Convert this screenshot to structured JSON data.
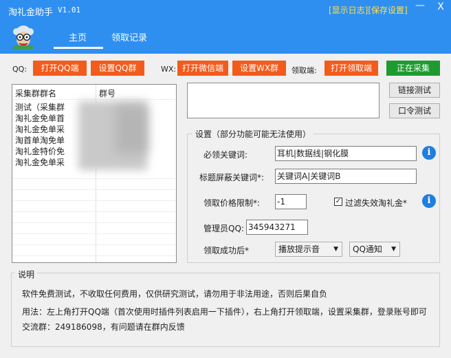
{
  "window": {
    "title": "淘礼金助手",
    "version": "V1.01",
    "show_log": "[显示日志]",
    "save_settings": "[保存设置]",
    "minimize": "—",
    "close": "X"
  },
  "tabs": [
    {
      "label": "主页",
      "active": true
    },
    {
      "label": "领取记录",
      "active": false
    }
  ],
  "toolbar": {
    "qq_label": "QQ:",
    "open_qq": "打开QQ端",
    "set_qq_group": "设置QQ群",
    "wx_label": "WX:",
    "open_wechat": "打开微信端",
    "set_wx_group": "设置WX群",
    "receiver_label": "领取端:",
    "open_receiver": "打开领取端",
    "collecting": "正在采集"
  },
  "groups_table": {
    "headers": [
      "采集群群名",
      "群号"
    ],
    "rows": [
      {
        "name": "测试（采集群"
      },
      {
        "name": "淘礼金免单首"
      },
      {
        "name": "淘礼金免单采"
      },
      {
        "name": "淘首单淘免单"
      },
      {
        "name": "淘礼金特价免"
      },
      {
        "name": "淘礼金免单采"
      }
    ]
  },
  "side_buttons": {
    "link_test": "链接测试",
    "password_test": "口令测试"
  },
  "settings": {
    "legend": "设置（部分功能可能无法使用）",
    "required_keywords_label": "必领关键词:",
    "required_keywords_value": "耳机|数据线|钢化膜",
    "title_block_label": "标题屏蔽关键词*:",
    "title_block_value": "关键词A|关键词B",
    "price_limit_label": "领取价格限制*:",
    "price_limit_value": "-1",
    "filter_invalid_label": "过滤失效淘礼金*",
    "filter_invalid_checked": true,
    "admin_qq_label": "管理员QQ:",
    "admin_qq_value": "345943271",
    "on_success_label": "领取成功后*",
    "on_success_sound": "播放提示音",
    "on_success_notify": "QQ通知",
    "info_icon": "i"
  },
  "notes": {
    "legend": "说明",
    "line1": "软件免费测试，不收取任何费用，仅供研究测试，请勿用于非法用途，否则后果自负",
    "line2": "用法：左上角打开QQ端（首次使用时插件列表启用一下插件），右上角打开领取端，设置采集群，登录账号即可",
    "line3": "交流群：249186098，有问题请在群内反馈"
  },
  "colors": {
    "titlebar": "#2e8ff0",
    "orange_button": "#f35b1c",
    "green_button": "#1e9b2f",
    "link_yellow": "#ffe14d",
    "info_blue": "#1d7fe0"
  },
  "icons": {
    "avatar": "granny-avatar-icon",
    "info": "info-icon",
    "dropdown": "chevron-down-icon"
  }
}
